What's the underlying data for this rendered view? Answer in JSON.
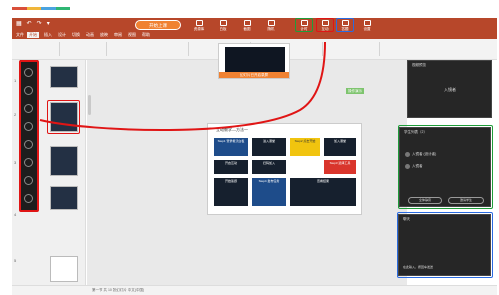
{
  "brand_stripe": {
    "colors": [
      "#d94f3a",
      "#f0b63a",
      "#4aa3df",
      "#2fb673"
    ]
  },
  "qat": {
    "items": [
      "▦",
      "↶",
      "↷",
      "▾"
    ]
  },
  "tabs": [
    {
      "label": "文件",
      "active": false
    },
    {
      "label": "开始",
      "active": true
    },
    {
      "label": "插入",
      "active": false
    },
    {
      "label": "设计",
      "active": false
    },
    {
      "label": "切换",
      "active": false
    },
    {
      "label": "动画",
      "active": false
    },
    {
      "label": "放映",
      "active": false
    },
    {
      "label": "审阅",
      "active": false
    },
    {
      "label": "视图",
      "active": false
    },
    {
      "label": "帮助",
      "active": false
    }
  ],
  "start_button": {
    "label": "开始上课"
  },
  "toolbar": {
    "tools": [
      {
        "label": "资源库"
      },
      {
        "label": "白板"
      },
      {
        "label": "截图"
      },
      {
        "label": "随机"
      },
      {
        "label": "计时"
      },
      {
        "label": "互动"
      },
      {
        "label": "答题"
      },
      {
        "label": "设置"
      }
    ]
  },
  "popup": {
    "label": "幻灯片已开启录屏"
  },
  "canvas": {
    "tag": "操作演示",
    "slide_title": "互动教学—方法一",
    "steps": [
      {
        "label": "Step1 登录希沃白板",
        "color": "blue"
      },
      {
        "label": "进入课堂",
        "color": "dark"
      },
      {
        "label": "Step2 点击开始",
        "color": "yellow"
      },
      {
        "label": "加入课堂",
        "color": "dark"
      },
      {
        "label": "开启互动",
        "color": "dark"
      },
      {
        "label": "扫码加入",
        "color": "dark"
      },
      {
        "label": "Step3 选择工具",
        "color": "red"
      },
      {
        "label": "开始答题",
        "color": "dark"
      },
      {
        "label": "Step4 发布任务",
        "color": "blue"
      },
      {
        "label": "查看结果",
        "color": "dark"
      }
    ]
  },
  "right_top_panel": {
    "title": "视频预览",
    "center_text": "入镜者"
  },
  "right_mid_panel": {
    "title": "学生列表（2）",
    "rows": [
      {
        "name": "入镜者 (设计者)"
      },
      {
        "name": "入镜者"
      }
    ],
    "buttons": [
      "全体静音",
      "邀请学生"
    ]
  },
  "right_bottom_panel": {
    "title": "聊天",
    "footer": "在此输入，按回车发送"
  },
  "statusbar": {
    "text": "第一节 共 10 张幻灯片  中文(中国)"
  },
  "thumb_numbers": [
    "1",
    "2",
    "3",
    "4",
    "5"
  ]
}
